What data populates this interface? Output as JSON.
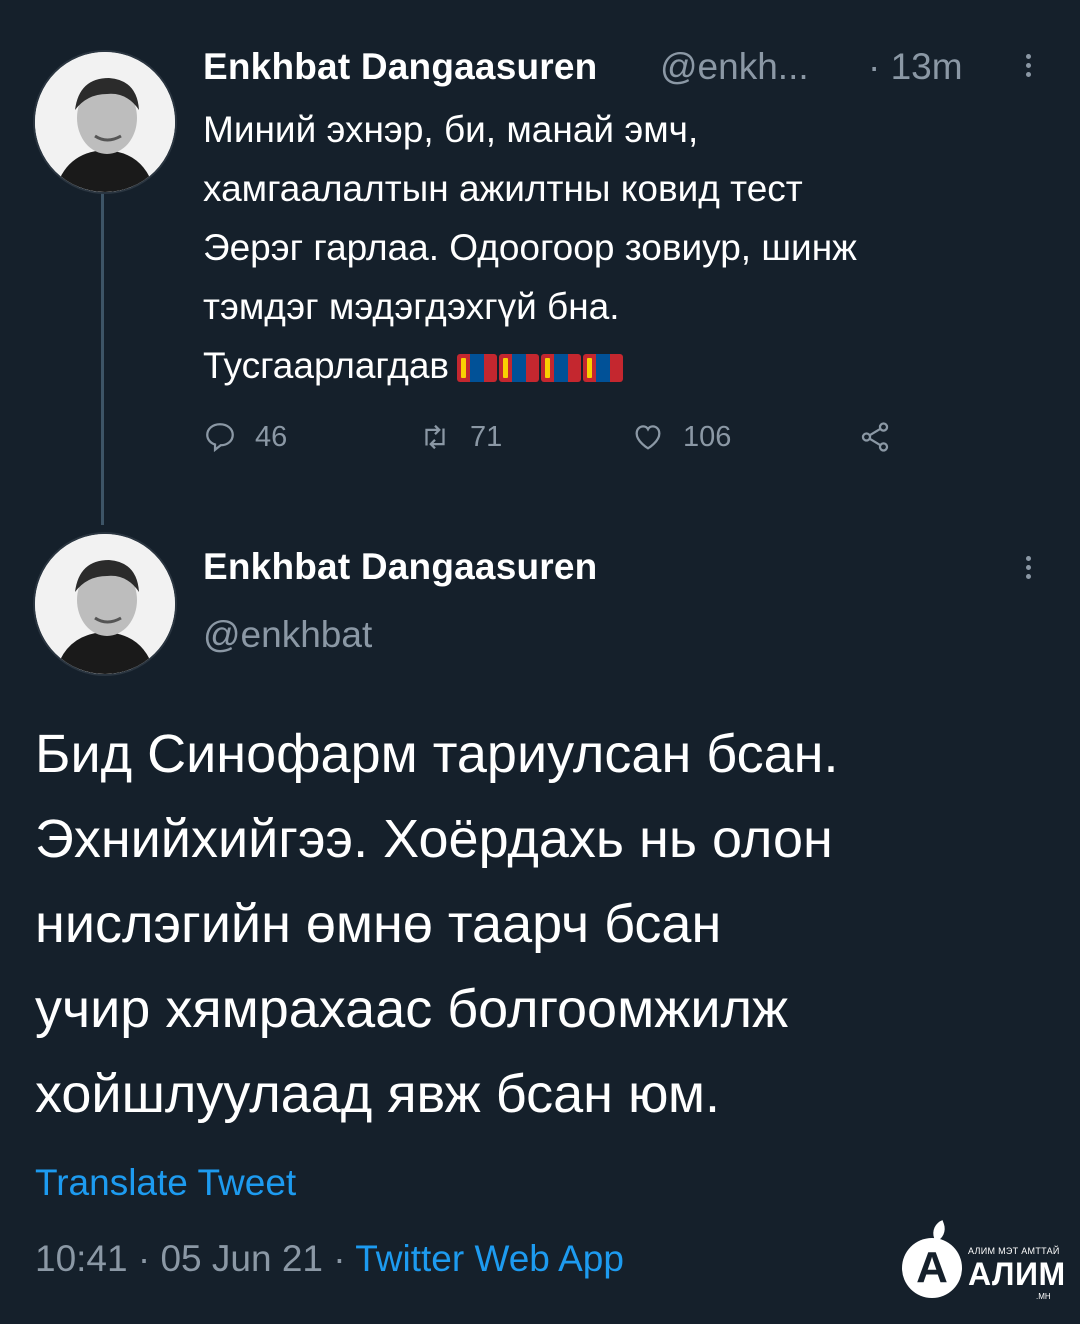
{
  "colors": {
    "background": "#15202b",
    "text": "#ffffff",
    "muted": "#8b98a5",
    "link": "#1d9bf0"
  },
  "tweet1": {
    "author_name": "Enkhbat Dangaasuren",
    "handle": "@enkh...",
    "time": "· 13m",
    "text_lines": [
      "Миний эхнэр, би, манай эмч,",
      "хамгаалалтын ажилтны ковид тест",
      "Эерэг гарлаа. Одоогоор зовиур, шинж",
      "тэмдэг мэдэгдэхгүй бна.",
      "Тусгаарлагдав"
    ],
    "emoji": "mongolia-flag-emoji",
    "replies": "46",
    "retweets": "71",
    "likes": "106",
    "icons": [
      "reply-icon",
      "retweet-icon",
      "like-icon",
      "share-icon",
      "more-options-icon"
    ]
  },
  "tweet2": {
    "author_name": "Enkhbat Dangaasuren",
    "handle": "@enkhbat",
    "text_lines": [
      "Бид Синофарм тариулсан бсан.",
      "Эхнийхийгээ. Хоёрдахь нь олон",
      "нислэгийн өмнө таарч бсан",
      "учир хямрахаас болгоомжилж",
      "хойшлуулаад явж бсан юм."
    ],
    "translate_label": "Translate Tweet",
    "timestamp": "10:41 · 05 Jun 21 · ",
    "source": "Twitter Web App"
  },
  "watermark": {
    "letter": "А",
    "tagline": "АЛИМ МЭТ АМТТАЙ",
    "brand": "АЛИМ",
    "domain": ".МН"
  }
}
